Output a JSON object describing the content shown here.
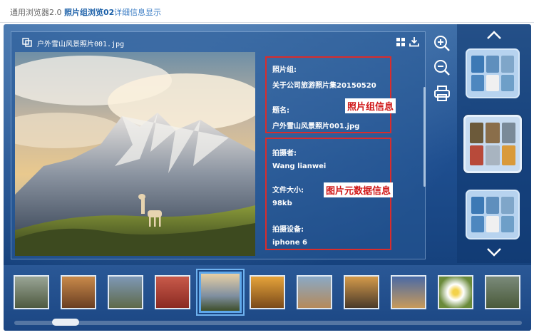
{
  "breadcrumb": {
    "items": [
      "通用浏览器2.0",
      "照片组浏览02",
      "详细信息显示"
    ]
  },
  "viewer": {
    "file_title": "户外雪山风景照片001.jpg",
    "group_label": "照片组:",
    "group_value": "关于公司旅游照片集20150520",
    "title_label": "题名:",
    "title_value": "户外雪山风景照片001.jpg",
    "group_tag": "照片组信息",
    "photographer_label": "拍摄者:",
    "photographer_value": "Wang lianwei",
    "size_label": "文件大小:",
    "size_value": "98kb",
    "device_label": "拍摄设备:",
    "device_value": "iphone 6",
    "meta_tag": "图片元数据信息"
  },
  "icons": [
    "copy-icon",
    "grid-view-icon",
    "download-icon",
    "zoom-in-icon",
    "zoom-out-icon",
    "print-icon",
    "chevron-up-icon",
    "chevron-down-icon"
  ],
  "colors": {
    "accent": "#1a5fa8",
    "highlight_box": "#d92c2c",
    "stage_dark": "#113a72"
  },
  "thumbnails": [
    "people-bench",
    "rock-arch",
    "road-valley",
    "red-flower",
    "snow-mountain",
    "sailboat-sunset",
    "cathedral",
    "sunset-street",
    "lighthouse",
    "daisy",
    "rocky-shore"
  ],
  "active_thumbnail": 4
}
